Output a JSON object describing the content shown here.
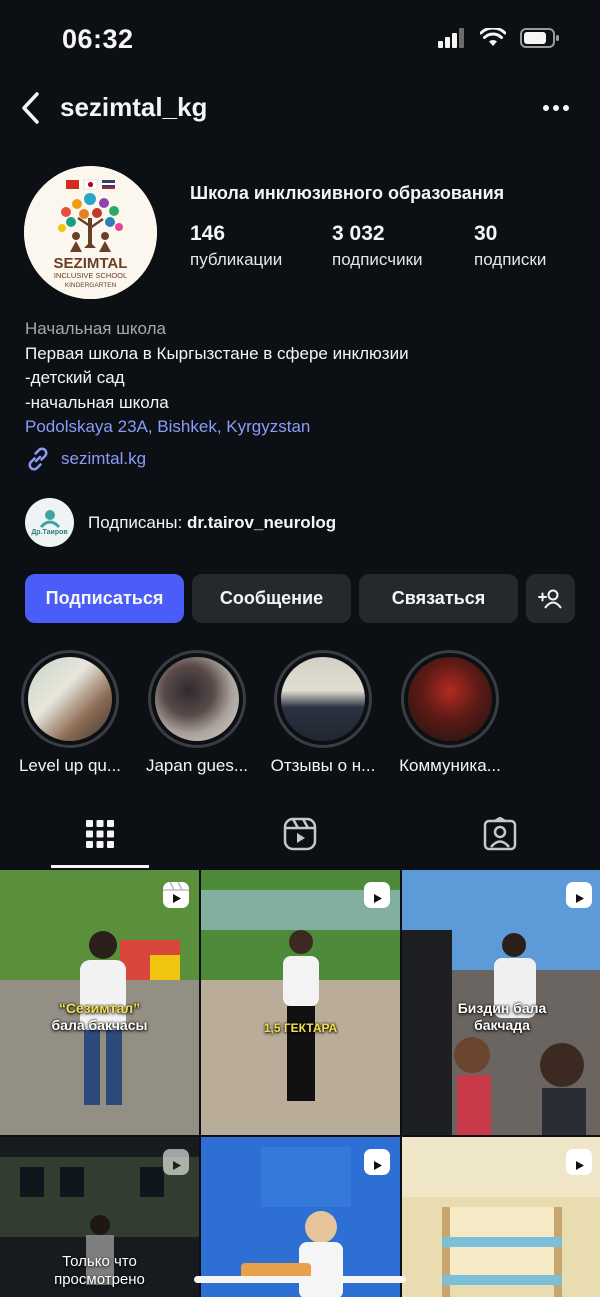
{
  "status": {
    "time": "06:32"
  },
  "nav": {
    "username": "sezimtal_kg"
  },
  "profile": {
    "category_title": "Школа инклюзивного образования",
    "avatar_text": {
      "name": "SEZIMTAL",
      "sub1": "INCLUSIVE SCHOOL",
      "sub2": "KINDERGARTEN"
    },
    "stats": [
      {
        "value": "146",
        "label": "публикации"
      },
      {
        "value": "3 032",
        "label": "подписчики"
      },
      {
        "value": "30",
        "label": "подписки"
      }
    ],
    "bio": {
      "category": "Начальная школа",
      "line1": "Первая школа в Кыргызстане в сфере инклюзии",
      "line2": "-детский сад",
      "line3": "-начальная школа",
      "address": "Podolskaya 23A, Bishkek, Kyrgyzstan"
    },
    "website": "sezimtal.kg",
    "followed_by": {
      "prefix": "Подписаны: ",
      "user": "dr.tairov_neurolog",
      "avatar_text": "Др.Таиров"
    }
  },
  "actions": {
    "follow": "Подписаться",
    "message": "Сообщение",
    "contact": "Связаться"
  },
  "highlights": [
    {
      "label": "Level up qu..."
    },
    {
      "label": "Japan gues..."
    },
    {
      "label": "Отзывы о н..."
    },
    {
      "label": "Коммуника..."
    }
  ],
  "posts": [
    {
      "caption_line1": "“Сезимтал”",
      "caption_line2": "бала бакчасы"
    },
    {
      "caption_line1": "1,5 ГЕКТАРА"
    },
    {
      "caption_line1": "Биздин бала",
      "caption_line2": "бакчада"
    },
    {
      "watched_line1": "Только что",
      "watched_line2": "просмотрено"
    },
    {},
    {}
  ],
  "colors": {
    "background": "#0c1014",
    "primary_button": "#4a5df9",
    "link": "#8a9cf7",
    "secondary_button": "#25292e"
  },
  "icons": [
    "back-chevron-icon",
    "more-dots-icon",
    "link-icon",
    "add-person-icon",
    "grid-icon",
    "reels-icon",
    "tagged-icon",
    "reel-badge-icon"
  ]
}
